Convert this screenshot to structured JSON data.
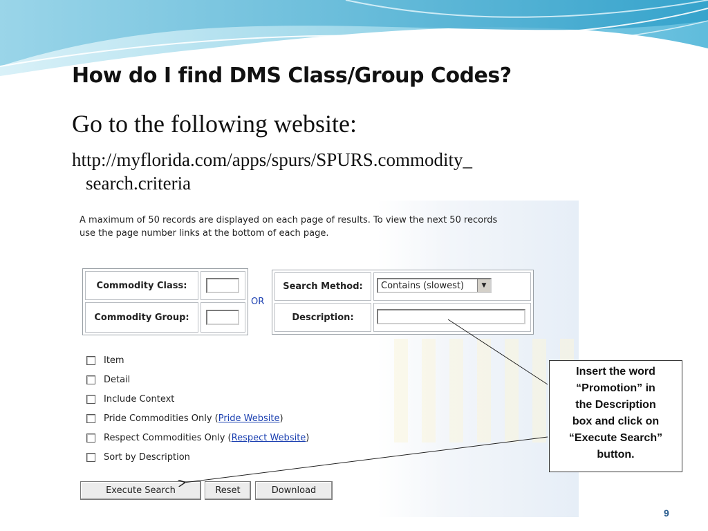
{
  "slide": {
    "title": "How do I find DMS Class/Group Codes?",
    "subtitle": "Go to the following website:",
    "url_line1": "http://myflorida.com/apps/spurs/SPURS.commodity_",
    "url_line2": "search.criteria",
    "page_number": "9"
  },
  "screenshot": {
    "notice_line1": "A maximum of 50 records are displayed on each page of results. To view the next 50 records",
    "notice_line2": "use the page number links at the bottom of each page.",
    "commodity_class_label": "Commodity Class:",
    "commodity_group_label": "Commodity Group:",
    "or_label": "OR",
    "search_method_label": "Search Method:",
    "search_method_value": "Contains (slowest)",
    "description_label": "Description:",
    "options": [
      {
        "label": "Item"
      },
      {
        "label": "Detail"
      },
      {
        "label": "Include Context"
      },
      {
        "label": "Pride Commodities Only (",
        "link": "Pride Website",
        "suffix": ")"
      },
      {
        "label": "Respect Commodities Only (",
        "link": "Respect Website",
        "suffix": ")"
      },
      {
        "label": "Sort by Description"
      }
    ],
    "buttons": {
      "execute": "Execute Search",
      "reset": "Reset",
      "download": "Download"
    }
  },
  "callout": {
    "lines": [
      "Insert the word",
      "“Promotion” in",
      "the Description",
      "box and click on",
      "“Execute Search”",
      "button."
    ]
  },
  "colors": {
    "link": "#1a3fb0",
    "wave_light": "#bfe6f2",
    "wave_dark": "#3aa8cf",
    "page_number": "#2a5d8f"
  }
}
